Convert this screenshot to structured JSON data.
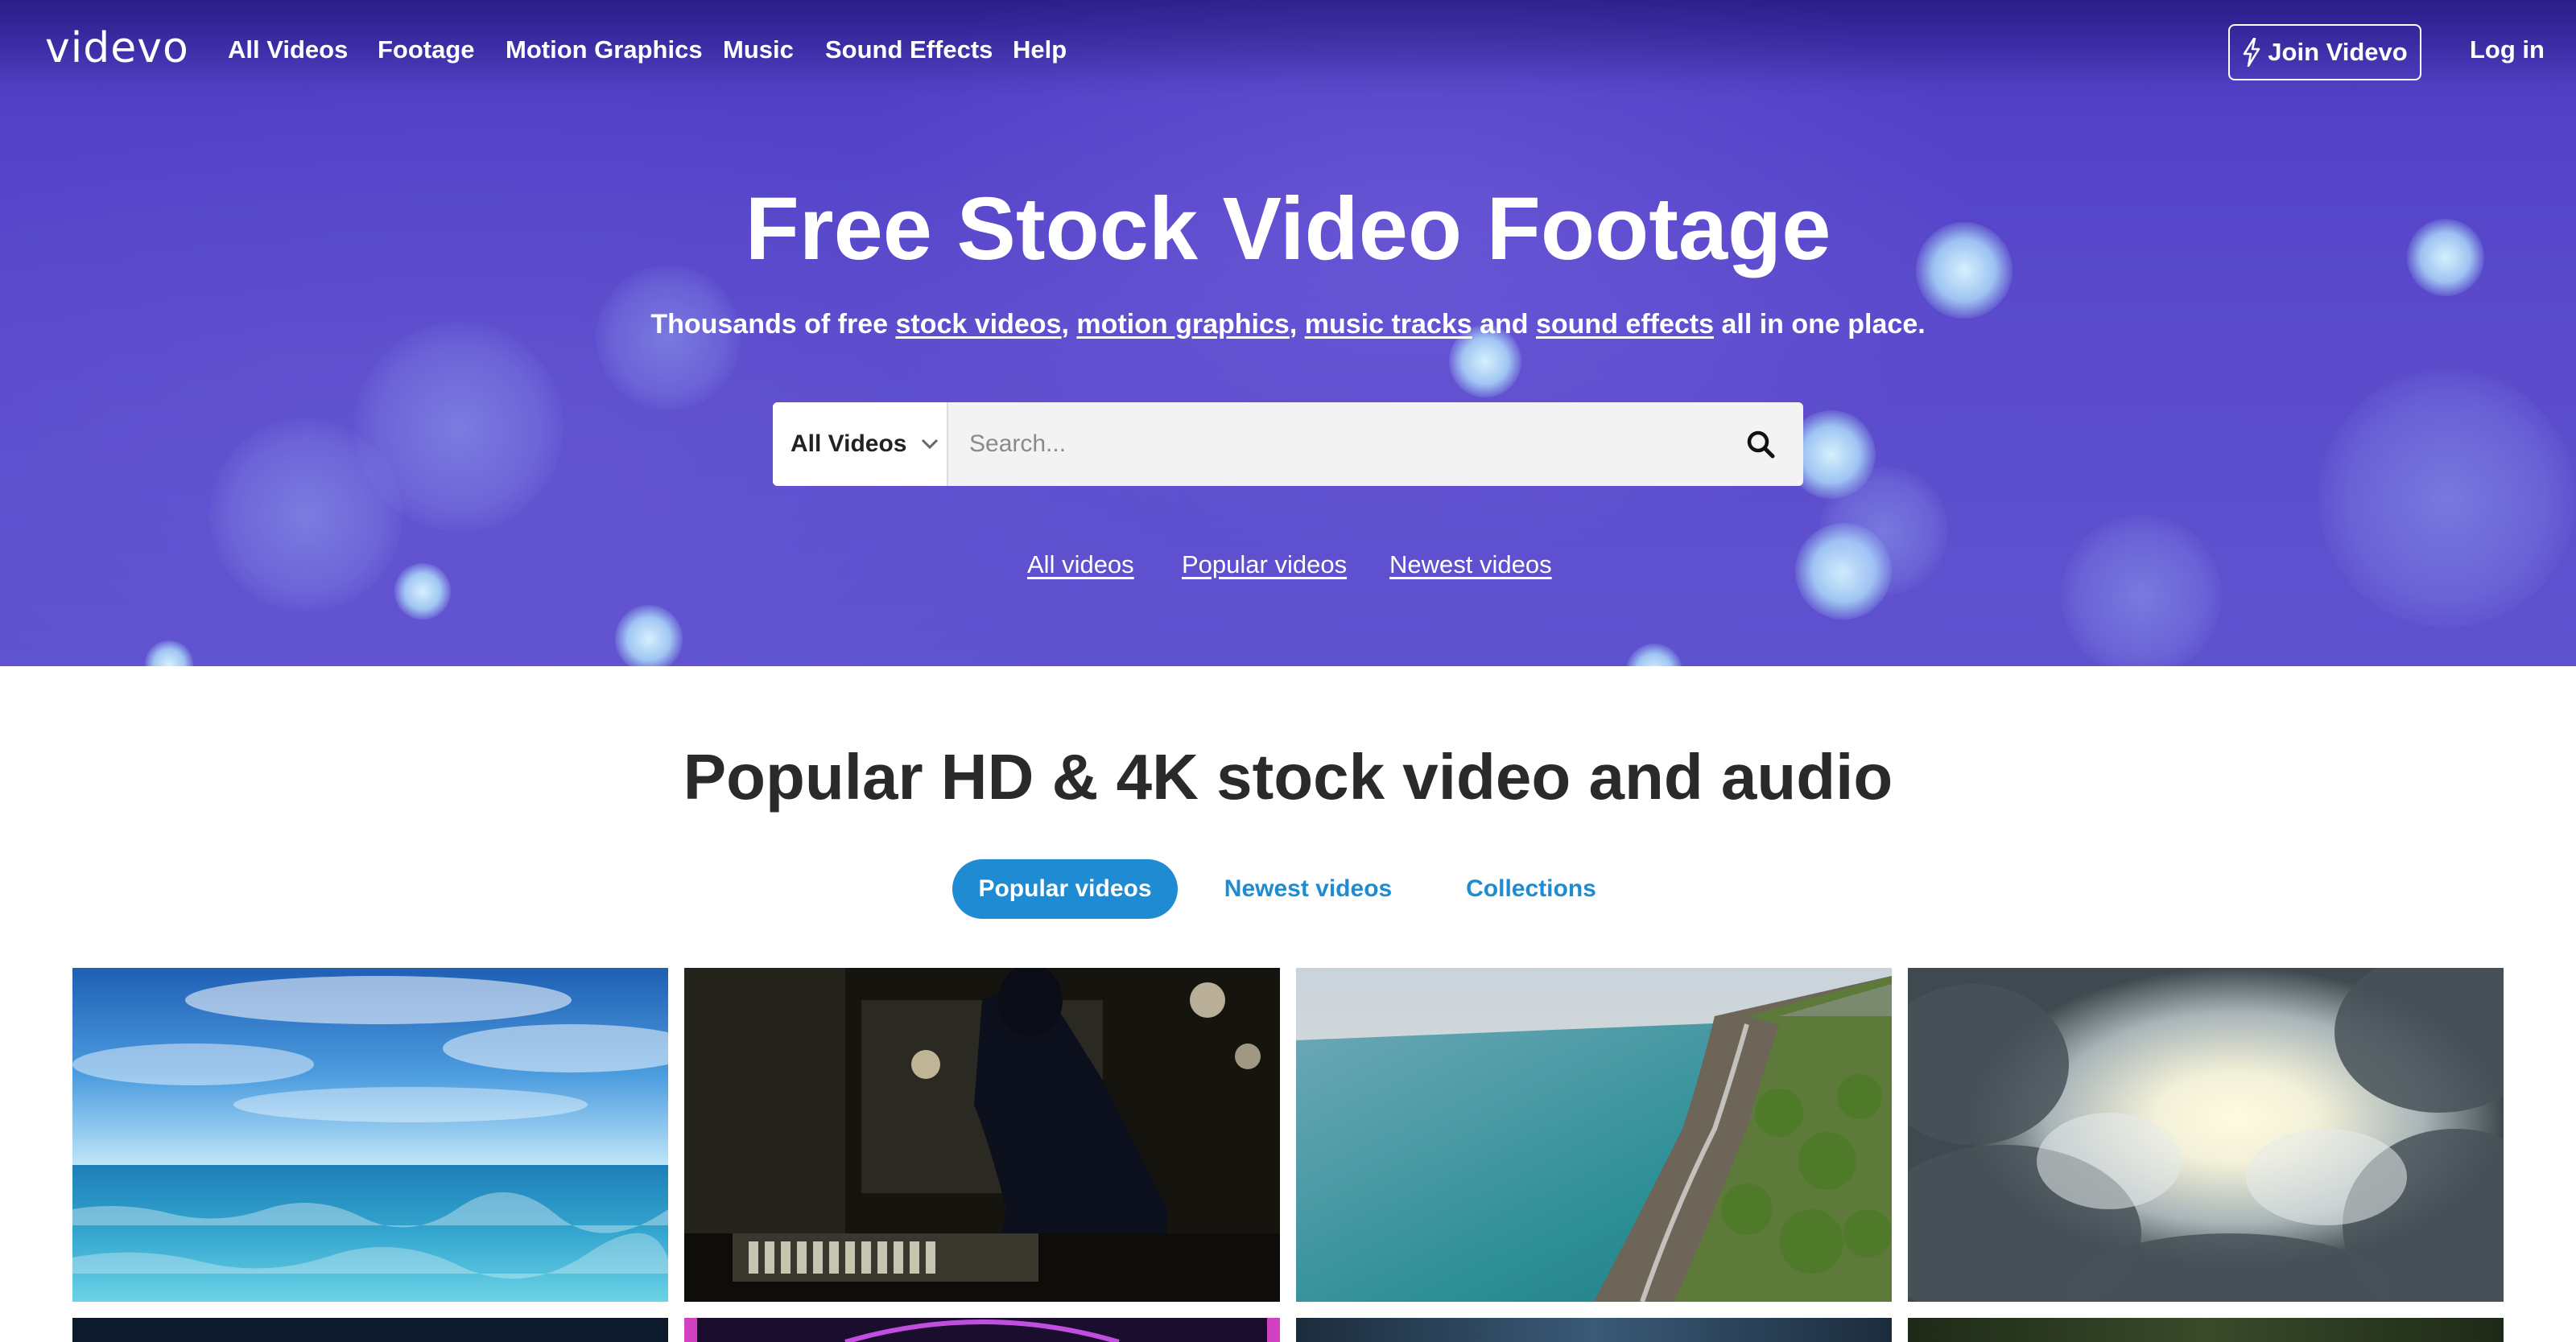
{
  "nav": {
    "logo": "videvo",
    "links": [
      "All Videos",
      "Footage",
      "Motion Graphics",
      "Music",
      "Sound Effects",
      "Help"
    ],
    "join_label": "Join Videvo",
    "login_label": "Log in"
  },
  "hero": {
    "title": "Free Stock Video Footage",
    "subtitle": {
      "prefix": "Thousands of free ",
      "link1": "stock videos",
      "sep1": ", ",
      "link2": "motion graphics",
      "sep2": ", ",
      "link3": "music tracks",
      "sep3": " and ",
      "link4": "sound effects",
      "suffix": " all in one place."
    },
    "search": {
      "category": "All Videos",
      "placeholder": "Search..."
    },
    "quick_links": [
      "All videos",
      "Popular videos",
      "Newest videos"
    ]
  },
  "section": {
    "title": "Popular HD & 4K stock video and audio",
    "tabs": [
      "Popular videos",
      "Newest videos",
      "Collections"
    ]
  },
  "colors": {
    "accent": "#1e8bd2",
    "hero_purple": "#5b4bcc"
  },
  "icons": [
    "bolt-icon",
    "chevron-down-icon",
    "search-icon"
  ]
}
